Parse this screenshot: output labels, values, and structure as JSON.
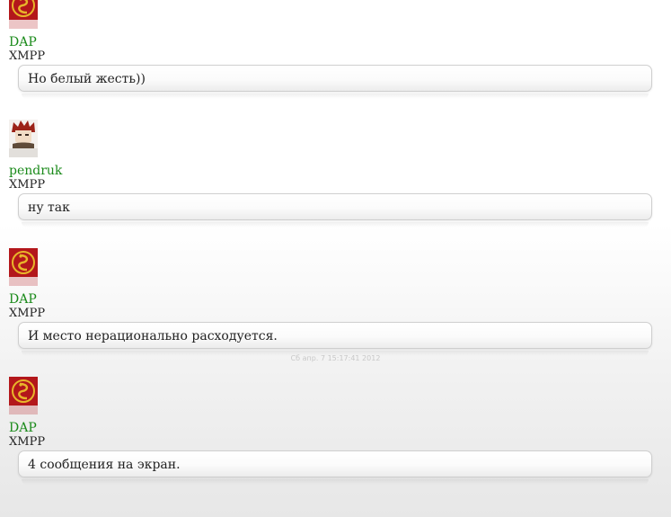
{
  "messages": [
    {
      "avatar_icon": "dragon-emblem-icon",
      "nick": "DAP",
      "protocol": "XMPP",
      "text": "Но белый жесть))"
    },
    {
      "avatar_icon": "anime-character-avatar-icon",
      "nick": "pendruk",
      "protocol": "XMPP",
      "text": "ну так"
    },
    {
      "avatar_icon": "dragon-emblem-icon",
      "nick": "DAP",
      "protocol": "XMPP",
      "text": "И место нерационально расходуется.",
      "timestamp": "Сб апр. 7 15:17:41 2012"
    },
    {
      "avatar_icon": "dragon-emblem-icon",
      "nick": "DAP",
      "protocol": "XMPP",
      "text": "4 сообщения на экран."
    }
  ],
  "colors": {
    "nick": "#1a8a1a",
    "dragon_avatar_bg": "#b3171b",
    "dragon_gold": "#e8b52a"
  }
}
